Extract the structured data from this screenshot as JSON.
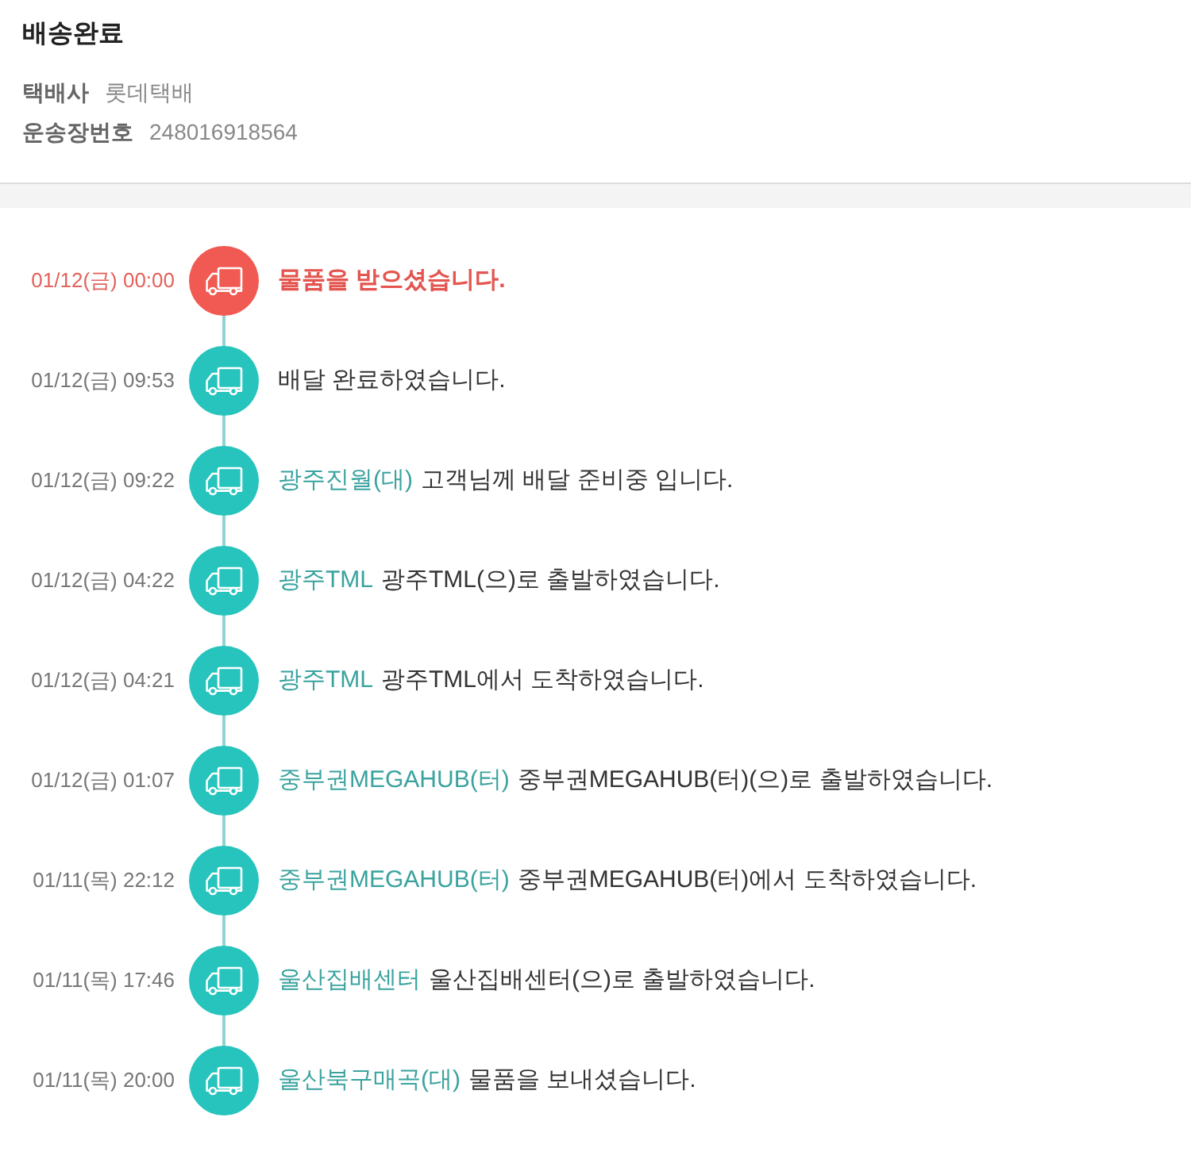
{
  "header": {
    "title": "배송완료",
    "info": [
      {
        "label": "택배사",
        "value": "롯데택배"
      },
      {
        "label": "운송장번호",
        "value": "248016918564"
      }
    ]
  },
  "events": [
    {
      "time": "01/12(금) 00:00",
      "message": "물품을 받으셨습니다.",
      "highlighted": true
    },
    {
      "time": "01/12(금) 09:53",
      "message": "배달 완료하였습니다.",
      "highlighted": false
    },
    {
      "time": "01/12(금) 09:22",
      "location": "광주진월(대)",
      "message": "고객님께 배달 준비중 입니다.",
      "highlighted": false
    },
    {
      "time": "01/12(금) 04:22",
      "location": "광주TML",
      "message": "광주TML(으)로 출발하였습니다.",
      "highlighted": false
    },
    {
      "time": "01/12(금) 04:21",
      "location": "광주TML",
      "message": "광주TML에서 도착하였습니다.",
      "highlighted": false
    },
    {
      "time": "01/12(금) 01:07",
      "location": "중부권MEGAHUB(터)",
      "message": "중부권MEGAHUB(터)(으)로 출발하였습니다.",
      "highlighted": false
    },
    {
      "time": "01/11(목) 22:12",
      "location": "중부권MEGAHUB(터)",
      "message": "중부권MEGAHUB(터)에서 도착하였습니다.",
      "highlighted": false
    },
    {
      "time": "01/11(목) 17:46",
      "location": "울산집배센터",
      "message": "울산집배센터(으)로 출발하였습니다.",
      "highlighted": false
    },
    {
      "time": "01/11(목) 20:00",
      "location": "울산북구매곡(대)",
      "message": "물품을 보내셨습니다.",
      "highlighted": false
    }
  ]
}
